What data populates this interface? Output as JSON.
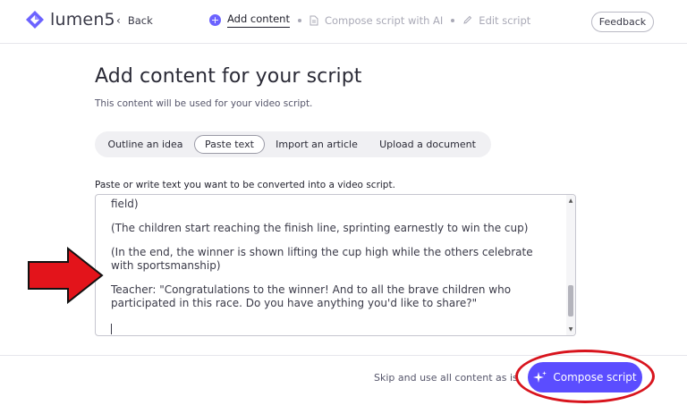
{
  "header": {
    "logo_text": "lumen5",
    "back_label": "Back",
    "steps": [
      {
        "label": "Add content",
        "state": "active",
        "icon": "plus-circle-icon"
      },
      {
        "label": "Compose script with AI",
        "state": "inactive",
        "icon": "document-icon"
      },
      {
        "label": "Edit script",
        "state": "inactive",
        "icon": "pencil-icon"
      }
    ],
    "feedback_label": "Feedback"
  },
  "main": {
    "title": "Add content for your script",
    "subtitle": "This content will be used for your video script.",
    "tabs": [
      {
        "label": "Outline an idea",
        "active": false
      },
      {
        "label": "Paste text",
        "active": true
      },
      {
        "label": "Import an article",
        "active": false
      },
      {
        "label": "Upload a document",
        "active": false
      }
    ],
    "field_label": "Paste or write text you want to be converted into a video script.",
    "textarea": {
      "partial_top_line": "field)",
      "paragraphs": [
        "(The children start reaching the finish line, sprinting earnestly to win the cup)",
        "(In the end, the winner is shown lifting the cup high while the others celebrate with sportsmanship)",
        "Teacher: \"Congratulations to the winner! And to all the brave children who participated in this race. Do you have anything you'd like to share?\""
      ]
    }
  },
  "footer": {
    "skip_label": "Skip and use all content as is",
    "compose_label": "Compose script"
  },
  "annotations": {
    "arrow_color": "#e3141b",
    "ellipse_color": "#d8141d"
  },
  "colors": {
    "accent": "#5b4dff",
    "logo": "#6c63ff"
  }
}
